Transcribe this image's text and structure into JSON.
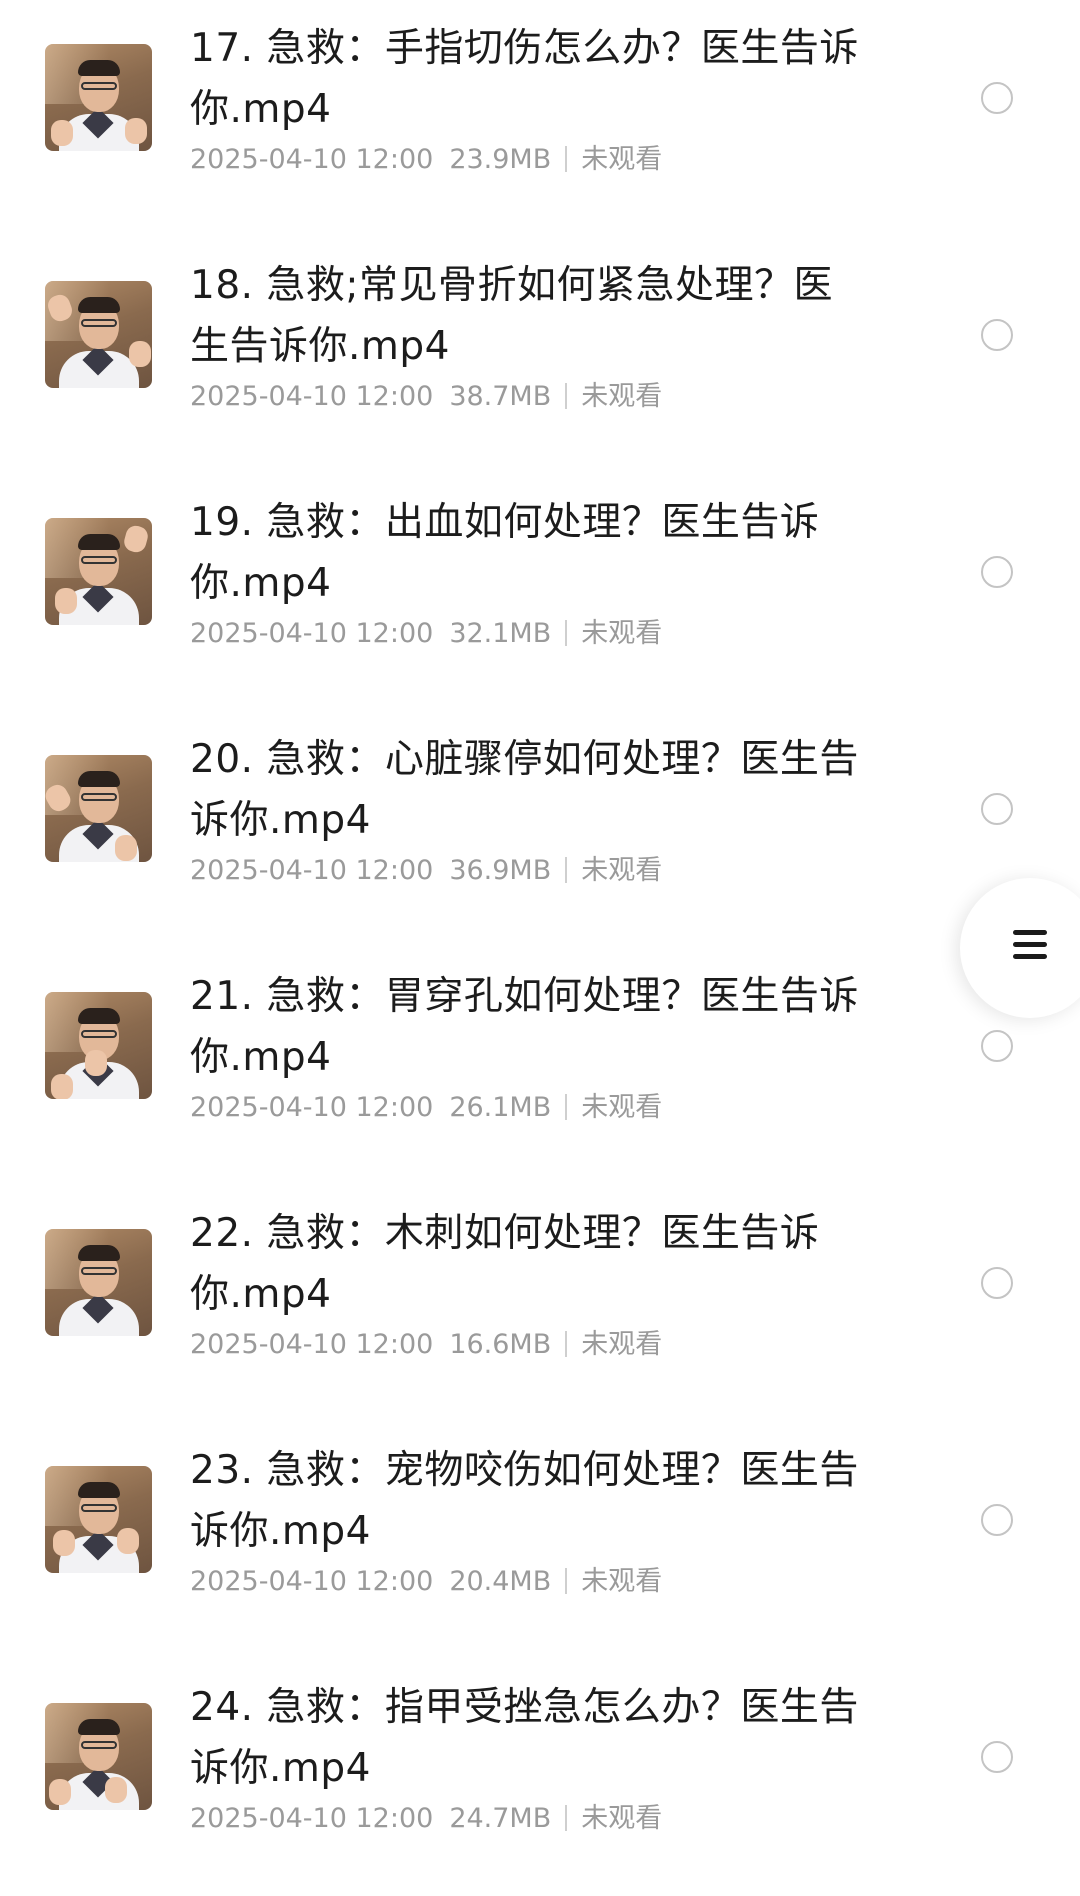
{
  "list": {
    "items": [
      {
        "title": "17. 急救：手指切伤怎么办？医生告诉你.mp4",
        "date": "2025-04-10 12:00",
        "size": "23.9MB",
        "status": "未观看"
      },
      {
        "title": "18. 急救;常见骨折如何紧急处理？医生告诉你.mp4",
        "date": "2025-04-10 12:00",
        "size": "38.7MB",
        "status": "未观看"
      },
      {
        "title": "19. 急救：出血如何处理？医生告诉你.mp4",
        "date": "2025-04-10 12:00",
        "size": "32.1MB",
        "status": "未观看"
      },
      {
        "title": "20. 急救：心脏骤停如何处理？医生告诉你.mp4",
        "date": "2025-04-10 12:00",
        "size": "36.9MB",
        "status": "未观看"
      },
      {
        "title": "21. 急救：胃穿孔如何处理？医生告诉你.mp4",
        "date": "2025-04-10 12:00",
        "size": "26.1MB",
        "status": "未观看"
      },
      {
        "title": "22. 急救：木刺如何处理？医生告诉你.mp4",
        "date": "2025-04-10 12:00",
        "size": "16.6MB",
        "status": "未观看"
      },
      {
        "title": "23. 急救：宠物咬伤如何处理？医生告诉你.mp4",
        "date": "2025-04-10 12:00",
        "size": "20.4MB",
        "status": "未观看"
      },
      {
        "title": "24. 急救：指甲受挫急怎么办？医生告诉你.mp4",
        "date": "2025-04-10 12:00",
        "size": "24.7MB",
        "status": "未观看"
      }
    ]
  },
  "floating_menu": {
    "icon": "menu-icon"
  }
}
